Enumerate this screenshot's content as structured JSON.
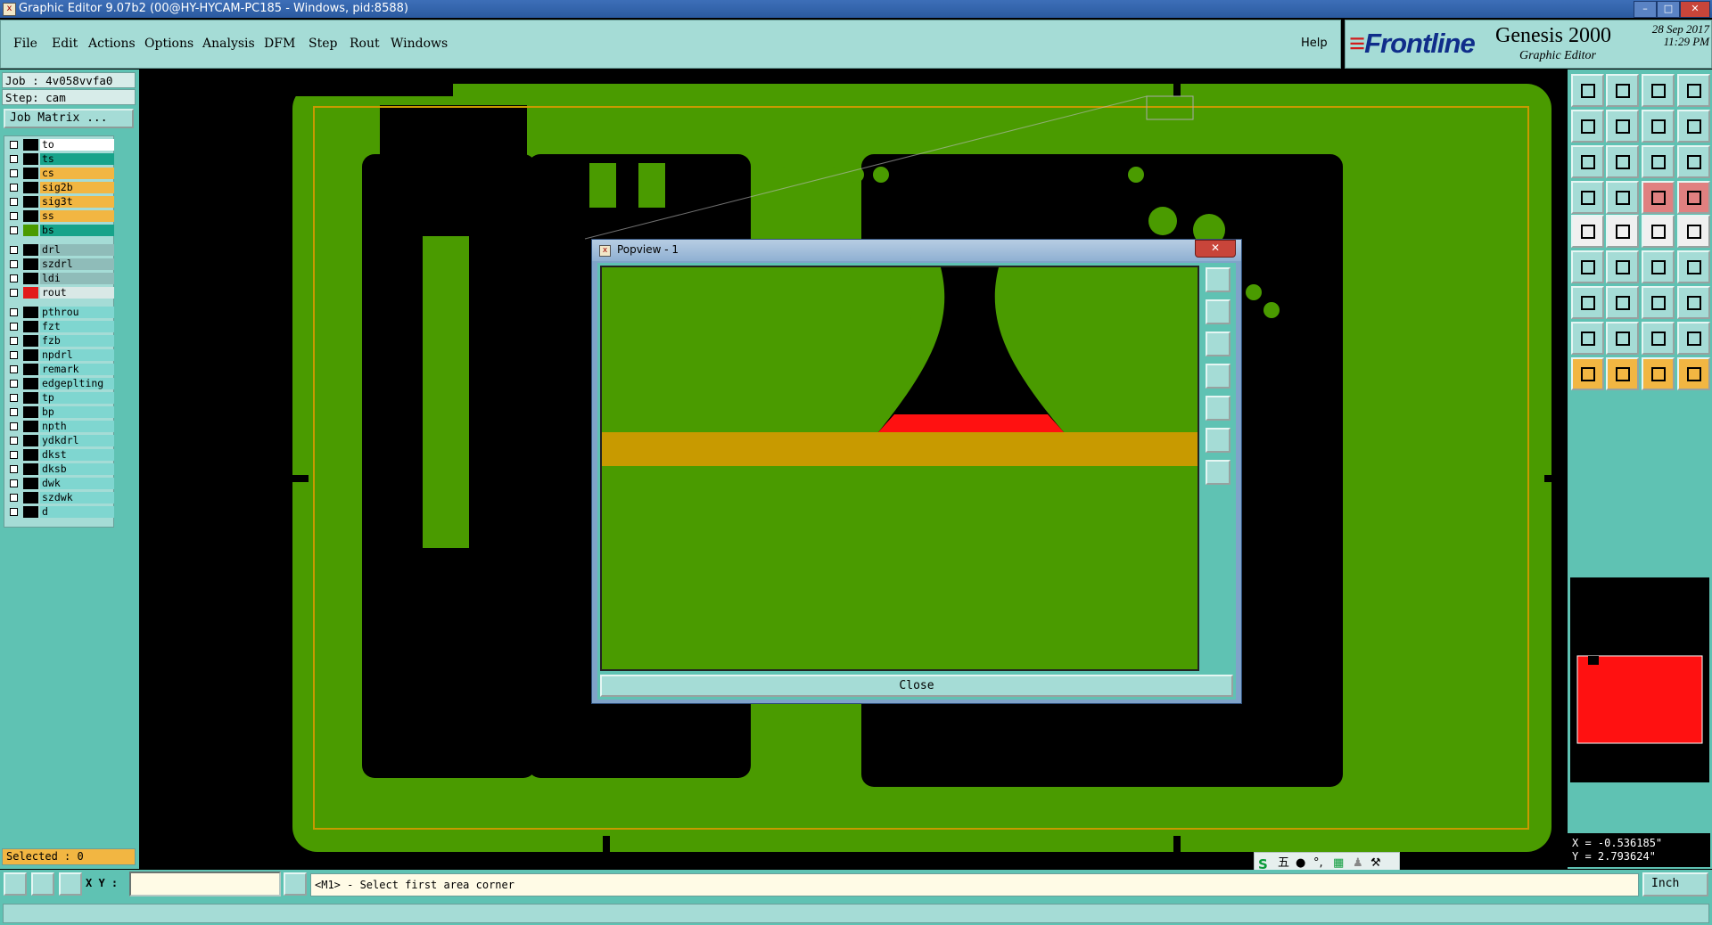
{
  "window": {
    "title": "Graphic Editor 9.07b2 (00@HY-HYCAM-PC185 - Windows, pid:8588)"
  },
  "menu": [
    "File",
    "Edit",
    "Actions",
    "Options",
    "Analysis",
    "DFM",
    "Step",
    "Rout",
    "Windows"
  ],
  "help_label": "Help",
  "brand": {
    "logo": "Frontline",
    "product": "Genesis 2000",
    "subtitle": "Graphic Editor",
    "date": "28 Sep 2017",
    "time": "11:29 PM"
  },
  "job": {
    "job_label": "Job : 4v058vvfa0",
    "step_label": "Step: cam",
    "matrix_button": "Job Matrix ..."
  },
  "layers": [
    {
      "name": "to",
      "bg": "#ffffff",
      "swatch": "#000000"
    },
    {
      "name": "ts",
      "bg": "#17a38a",
      "swatch": "#000000"
    },
    {
      "name": "cs",
      "bg": "#f2b642",
      "swatch": "#000000"
    },
    {
      "name": "sig2b",
      "bg": "#f2b642",
      "swatch": "#000000"
    },
    {
      "name": "sig3t",
      "bg": "#f2b642",
      "swatch": "#000000"
    },
    {
      "name": "ss",
      "bg": "#f2b642",
      "swatch": "#000000"
    },
    {
      "name": "bs",
      "bg": "#17a38a",
      "swatch": "#4a9b00"
    },
    {
      "name": "drl",
      "bg": "#8fbcb9",
      "swatch": "#000000"
    },
    {
      "name": "szdrl",
      "bg": "#8fbcb9",
      "swatch": "#000000"
    },
    {
      "name": "ldi",
      "bg": "#8fbcb9",
      "swatch": "#000000"
    },
    {
      "name": "rout",
      "bg": "#d9e8e6",
      "swatch": "#e21b1b"
    },
    {
      "name": "pthrou",
      "bg": "#7fd6d0",
      "swatch": "#000000"
    },
    {
      "name": "fzt",
      "bg": "#7fd6d0",
      "swatch": "#000000"
    },
    {
      "name": "fzb",
      "bg": "#7fd6d0",
      "swatch": "#000000"
    },
    {
      "name": "npdrl",
      "bg": "#7fd6d0",
      "swatch": "#000000"
    },
    {
      "name": "remark",
      "bg": "#7fd6d0",
      "swatch": "#000000"
    },
    {
      "name": "edgeplting",
      "bg": "#7fd6d0",
      "swatch": "#000000"
    },
    {
      "name": "tp",
      "bg": "#7fd6d0",
      "swatch": "#000000"
    },
    {
      "name": "bp",
      "bg": "#7fd6d0",
      "swatch": "#000000"
    },
    {
      "name": "npth",
      "bg": "#7fd6d0",
      "swatch": "#000000"
    },
    {
      "name": "ydkdrl",
      "bg": "#7fd6d0",
      "swatch": "#000000"
    },
    {
      "name": "dkst",
      "bg": "#7fd6d0",
      "swatch": "#000000"
    },
    {
      "name": "dksb",
      "bg": "#7fd6d0",
      "swatch": "#000000"
    },
    {
      "name": "dwk",
      "bg": "#7fd6d0",
      "swatch": "#000000"
    },
    {
      "name": "szdwk",
      "bg": "#7fd6d0",
      "swatch": "#000000"
    },
    {
      "name": "d",
      "bg": "#7fd6d0",
      "swatch": "#000000"
    }
  ],
  "selected_label": "Selected : 0",
  "popview": {
    "title": "Popview - 1",
    "close_label": "Close"
  },
  "coords": {
    "x": "X = -0.536185\"",
    "y": "Y = 2.793624\""
  },
  "status": {
    "xy_label": "X Y :",
    "xy_value": "",
    "message": "<M1> - Select first area corner",
    "units": "Inch"
  },
  "ime": {
    "char": "五"
  },
  "colors": {
    "board_green": "#4a9b00",
    "outline_gold": "#c89a00",
    "rout_red": "#ff1111",
    "panel_teal": "#5fc2b3"
  }
}
